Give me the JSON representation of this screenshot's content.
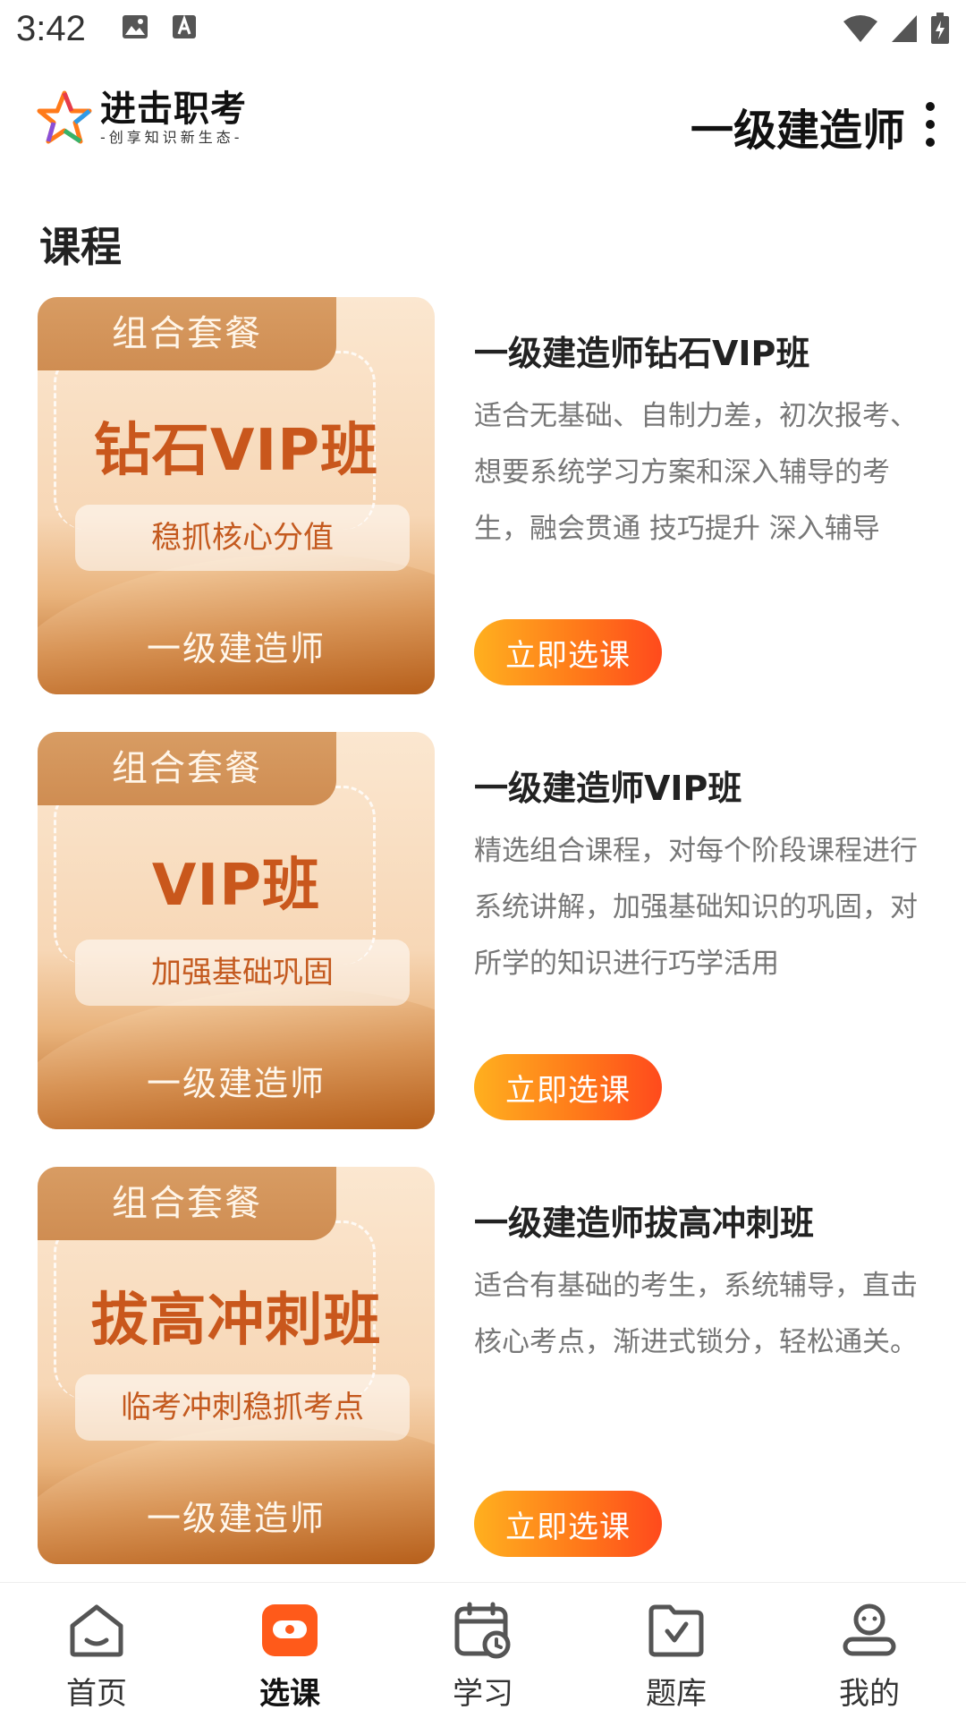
{
  "status_bar": {
    "time": "3:42"
  },
  "header": {
    "logo_name": "进击职考",
    "logo_sub": "-创享知识新生态-",
    "title": "一级建造师"
  },
  "section_title": "课程",
  "courses": [
    {
      "cover_tab": "组合套餐",
      "cover_name": "钻石VIP班",
      "cover_tagline": "稳抓核心分值",
      "cover_footer": "一级建造师",
      "title": "一级建造师钻石VIP班",
      "desc": "适合无基础、自制力差，初次报考、想要系统学习方案和深入辅导的考生，融会贯通 技巧提升 深入辅导",
      "button": "立即选课"
    },
    {
      "cover_tab": "组合套餐",
      "cover_name": "VIP班",
      "cover_tagline": "加强基础巩固",
      "cover_footer": "一级建造师",
      "title": "一级建造师VIP班",
      "desc": "精选组合课程，对每个阶段课程进行系统讲解，加强基础知识的巩固，对所学的知识进行巧学活用",
      "button": "立即选课"
    },
    {
      "cover_tab": "组合套餐",
      "cover_name": "拔高冲刺班",
      "cover_tagline": "临考冲刺稳抓考点",
      "cover_footer": "一级建造师",
      "title": "一级建造师拔高冲刺班",
      "desc": "适合有基础的考生，系统辅导，直击核心考点，渐进式锁分，轻松通关。",
      "button": "立即选课"
    }
  ],
  "bottom_nav": [
    {
      "label": "首页",
      "icon": "home-icon",
      "active": false
    },
    {
      "label": "选课",
      "icon": "course-select-icon",
      "active": true
    },
    {
      "label": "学习",
      "icon": "calendar-clock-icon",
      "active": false
    },
    {
      "label": "题库",
      "icon": "question-bank-icon",
      "active": false
    },
    {
      "label": "我的",
      "icon": "profile-icon",
      "active": false
    }
  ],
  "colors": {
    "accent": "#ff6a1a",
    "button_start": "#ffb01f",
    "button_end": "#ff4a1c",
    "cover_title": "#c9571c",
    "nav_active": "#ff5a1a"
  }
}
